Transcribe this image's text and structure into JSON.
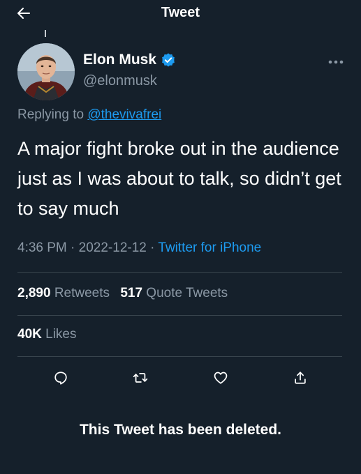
{
  "header": {
    "title": "Tweet",
    "back_icon": "arrow-left-icon"
  },
  "author": {
    "name": "Elon Musk",
    "handle": "@elonmusk",
    "verified": true,
    "verified_color": "#1d9bf0"
  },
  "reply": {
    "prefix": "Replying to",
    "target": "@thevivafrei"
  },
  "tweet": {
    "text": "A major fight broke out in the audience just as I was about to talk, so didn’t get to say much"
  },
  "meta": {
    "time": "4:36 PM",
    "separator": " · ",
    "date": "2022-12-12",
    "source": "Twitter for iPhone"
  },
  "stats": {
    "retweets_count": "2,890",
    "retweets_label": "Retweets",
    "quotes_count": "517",
    "quotes_label": "Quote Tweets",
    "likes_count": "40K",
    "likes_label": "Likes"
  },
  "actions": [
    {
      "name": "reply",
      "icon": "comment-icon"
    },
    {
      "name": "retweet",
      "icon": "retweet-icon"
    },
    {
      "name": "like",
      "icon": "heart-icon"
    },
    {
      "name": "share",
      "icon": "share-icon"
    }
  ],
  "notice": {
    "deleted": "This Tweet has been deleted."
  },
  "colors": {
    "background": "#15202b",
    "text_primary": "#ffffff",
    "text_secondary": "#8b98a5",
    "accent": "#1d9bf0",
    "divider": "#38444d"
  }
}
